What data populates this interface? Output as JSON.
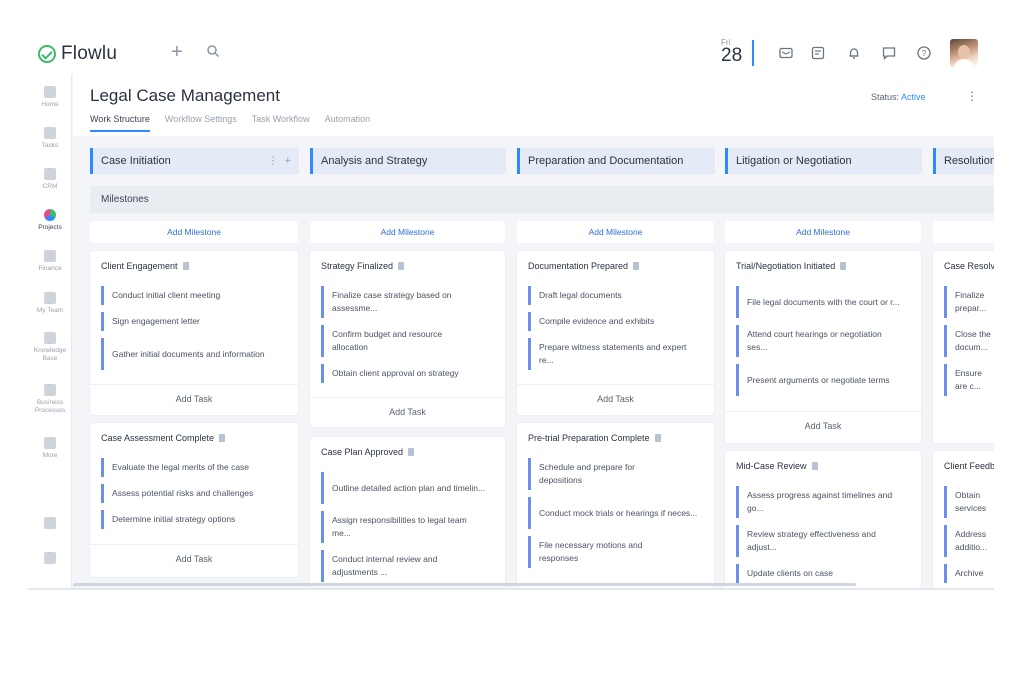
{
  "topbar": {
    "app_name": "Flowlu",
    "date_dow": "Fri",
    "date_day": "28"
  },
  "sidebar": {
    "items": [
      {
        "label": "Home",
        "icon": "home-icon"
      },
      {
        "label": "Tasks",
        "icon": "tasks-icon"
      },
      {
        "label": "CRM",
        "icon": "crm-icon"
      },
      {
        "label": "Projects",
        "icon": "projects-icon"
      },
      {
        "label": "Finance",
        "icon": "finance-icon"
      },
      {
        "label": "My Team",
        "icon": "team-icon"
      },
      {
        "label": "Knowledge Base",
        "icon": "knowledge-icon"
      },
      {
        "label": "Business Processes",
        "icon": "process-icon"
      },
      {
        "label": "More",
        "icon": "more-icon"
      }
    ]
  },
  "header": {
    "title": "Legal Case Management",
    "tabs": [
      "Work Structure",
      "Workflow Settings",
      "Task Workflow",
      "Automation"
    ],
    "status_label": "Status:",
    "status_value": "Active"
  },
  "board": {
    "milestones_label": "Milestones",
    "add_milestone_label": "Add Milestone",
    "add_task_label": "Add Task",
    "columns": [
      {
        "title": "Case Initiation",
        "cards": [
          {
            "title": "Client Engagement",
            "tasks": [
              "Conduct initial client meeting",
              "Sign engagement letter",
              "Gather initial documents and information"
            ]
          },
          {
            "title": "Case Assessment Complete",
            "tasks": [
              "Evaluate the legal merits of the case",
              "Assess potential risks and challenges",
              "Determine initial strategy options"
            ]
          }
        ]
      },
      {
        "title": "Analysis and Strategy",
        "cards": [
          {
            "title": "Strategy Finalized",
            "tasks": [
              "Finalize case strategy based on assessme...",
              "Confirm budget and resource allocation",
              "Obtain client approval on strategy"
            ]
          },
          {
            "title": "Case Plan Approved",
            "tasks": [
              "Outline detailed action plan and timelin...",
              "Assign responsibilities to legal team me...",
              "Conduct internal review and adjustments ..."
            ]
          }
        ]
      },
      {
        "title": "Preparation and Documentation",
        "cards": [
          {
            "title": "Documentation Prepared",
            "tasks": [
              "Draft legal documents",
              "Compile evidence and exhibits",
              "Prepare witness statements and expert re..."
            ]
          },
          {
            "title": "Pre-trial Preparation Complete",
            "tasks": [
              "Schedule and prepare for depositions",
              "Conduct mock trials or hearings if neces...",
              "File necessary motions and responses"
            ]
          }
        ]
      },
      {
        "title": "Litigation or Negotiation",
        "cards": [
          {
            "title": "Trial/Negotiation Initiated",
            "tasks": [
              "File legal documents with the court or r...",
              "Attend court hearings or negotiation ses...",
              "Present arguments or negotiate terms"
            ]
          },
          {
            "title": "Mid-Case Review",
            "tasks": [
              "Assess progress against timelines and go...",
              "Review strategy effectiveness and adjust...",
              "Update clients on case"
            ]
          }
        ]
      },
      {
        "title": "Resolution",
        "cards": [
          {
            "title": "Case Resolved",
            "tasks": [
              "Finalize prepar...",
              "Close the docum...",
              "Ensure are c..."
            ]
          },
          {
            "title": "Client Feedback",
            "tasks": [
              "Obtain services",
              "Address additio...",
              "Archive"
            ]
          }
        ]
      }
    ]
  }
}
